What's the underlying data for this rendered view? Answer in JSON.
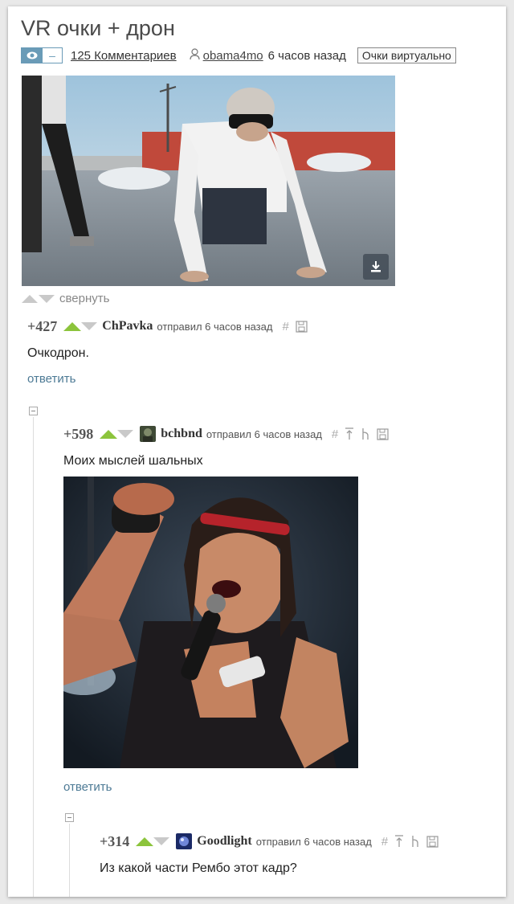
{
  "post": {
    "title": "VR очки + дрон",
    "comments_count": "125 Комментариев",
    "author": "obama4mo",
    "time": "6 часов назад",
    "tag": "Очки виртуально"
  },
  "video": {
    "alt": "download-icon"
  },
  "collapse": {
    "label": "свернуть"
  },
  "comments": [
    {
      "rating": "+427",
      "author": "ChPavka",
      "sent": "отправил 6 часов назад",
      "text": "Очкодрон.",
      "reply": "ответить"
    },
    {
      "rating": "+598",
      "author": "bchbnd",
      "sent": "отправил 6 часов назад",
      "text": "Моих мыслей шальных",
      "reply": "ответить"
    },
    {
      "rating": "+314",
      "author": "Goodlight",
      "sent": "отправил 6 часов назад",
      "text": "Из какой части Рембо этот кадр?"
    }
  ],
  "colors": {
    "accent": "#6a9bb7",
    "upvote": "#8cc43c",
    "link": "#4d7a95"
  }
}
